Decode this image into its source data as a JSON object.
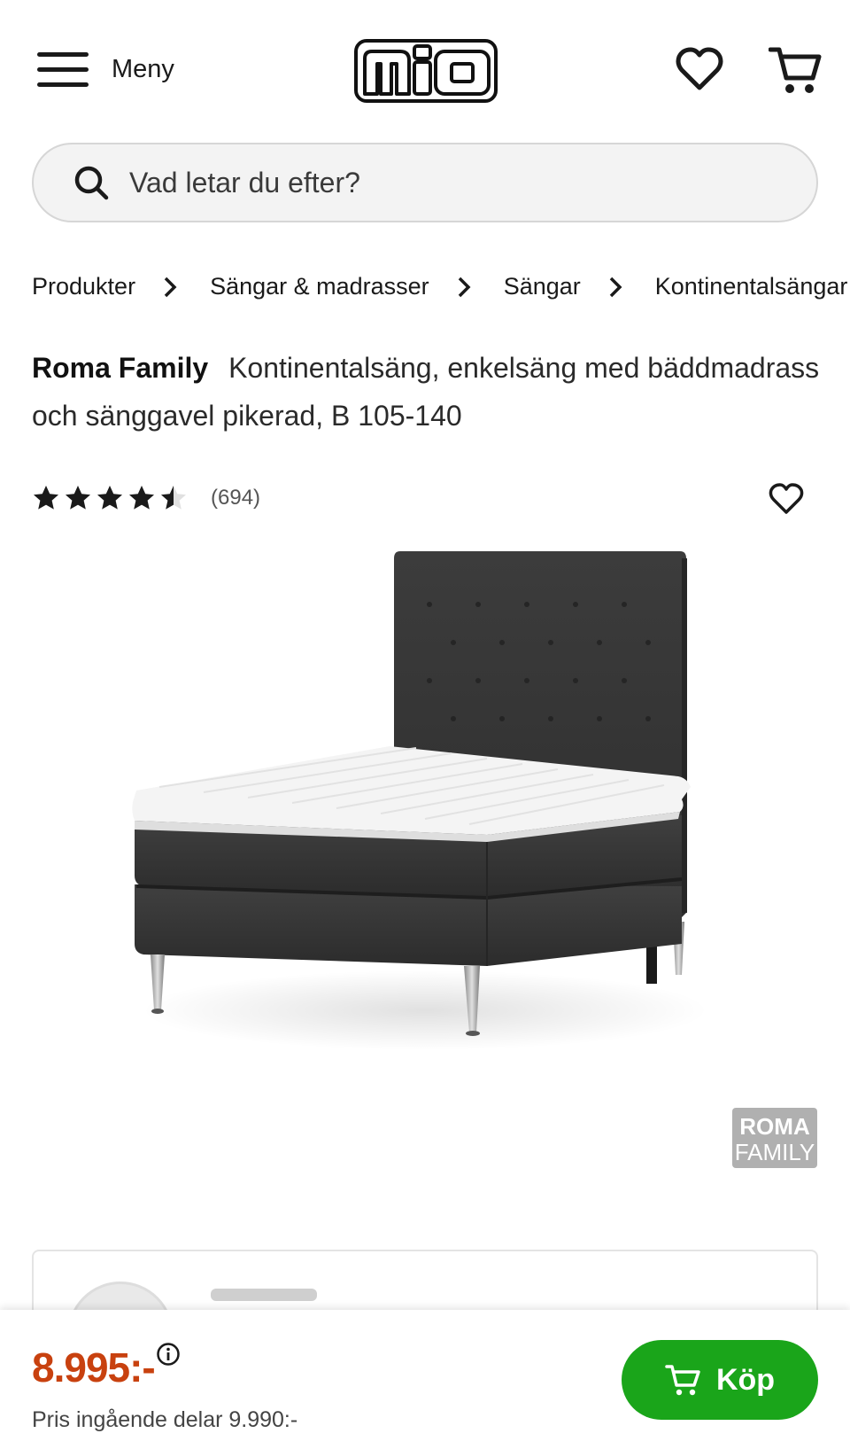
{
  "header": {
    "menu_label": "Meny",
    "logo_text": "mio",
    "wishlist_icon": "heart-icon",
    "cart_icon": "cart-icon"
  },
  "search": {
    "placeholder": "Vad letar du efter?",
    "icon": "search-icon"
  },
  "breadcrumb": {
    "items": [
      "Produkter",
      "Sängar & madrasser",
      "Sängar",
      "Kontinentalsängar"
    ]
  },
  "product": {
    "brand": "Roma Family",
    "title": "Kontinentalsäng, enkelsäng med bäddmadrass och sänggavel pikerad, B 105-140",
    "rating": 4.5,
    "rating_max": 5,
    "review_count": "(694)",
    "badge_line1": "ROMA",
    "badge_line2": "FAMILY"
  },
  "colors": {
    "price": "#c8410f",
    "buy_button": "#1aa51a",
    "bed_fabric": "#3a3a3a",
    "mattress_topper": "#f2f2f2"
  },
  "buybar": {
    "price": "8.995:-",
    "price_note": "Pris ingående delar 9.990:-",
    "buy_label": "Köp",
    "info_icon": "info-icon"
  }
}
